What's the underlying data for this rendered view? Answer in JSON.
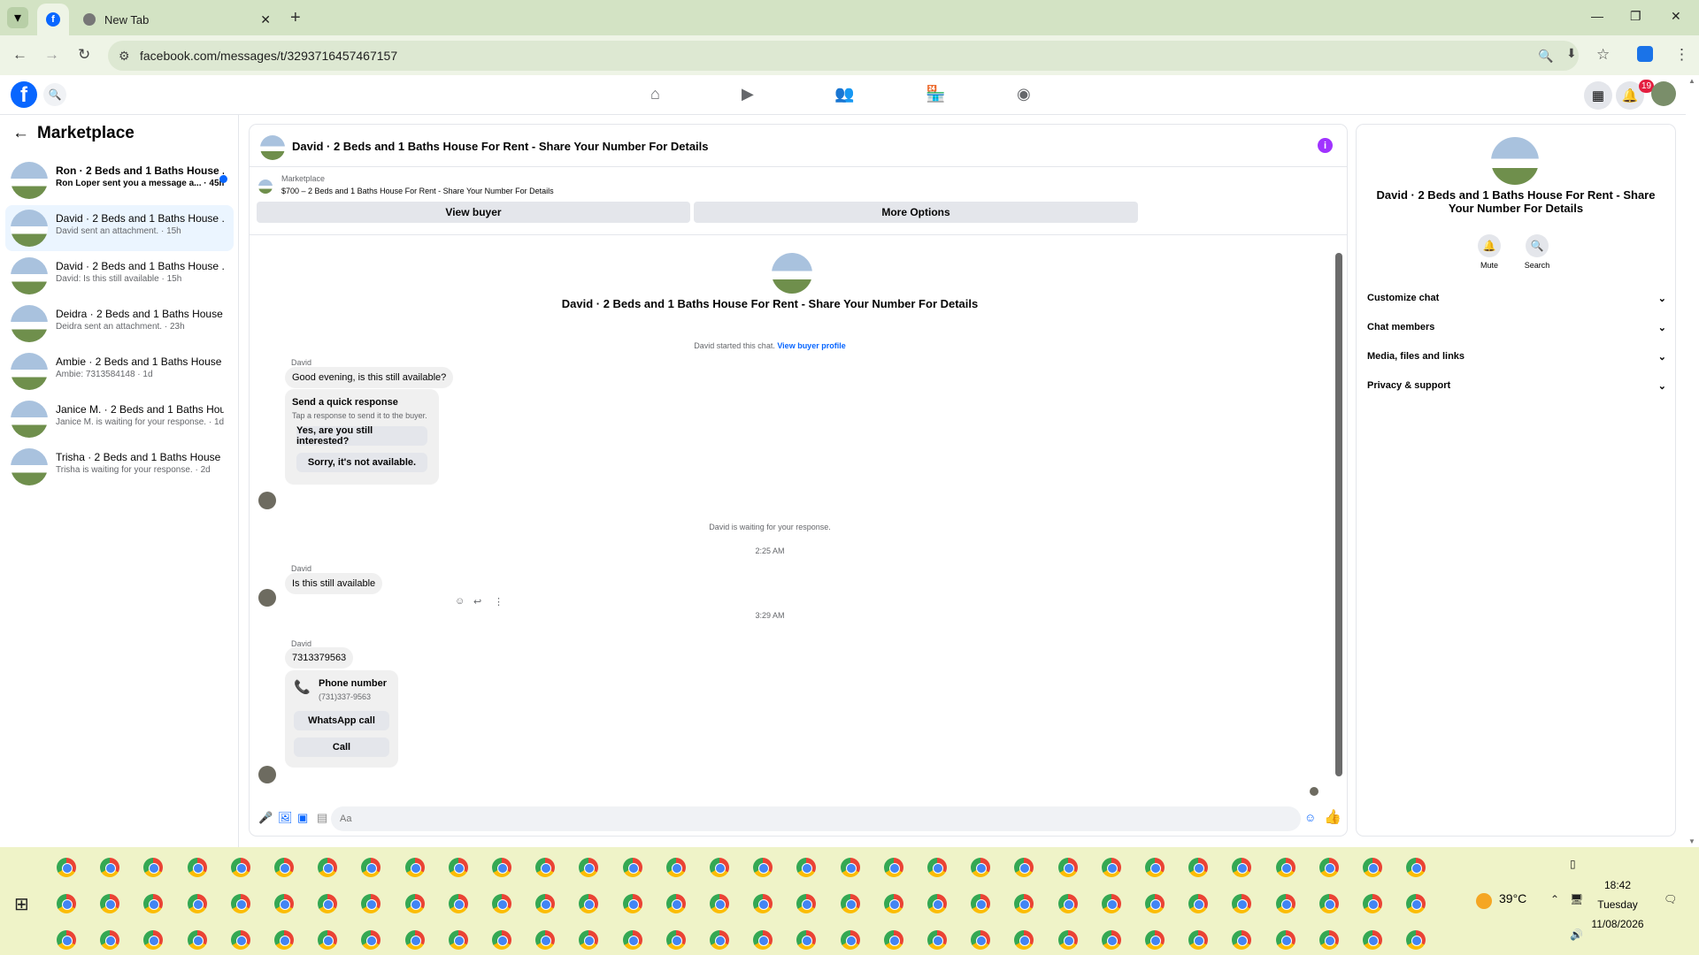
{
  "browser": {
    "tabs": [
      {
        "label": "",
        "icon": "facebook-icon",
        "active": true
      },
      {
        "label": "New Tab",
        "icon": "chrome-icon",
        "active": false
      }
    ],
    "url": "facebook.com/messages/t/3293716457467157"
  },
  "fb": {
    "notif_count": "19"
  },
  "left": {
    "title": "Marketplace",
    "conversations": [
      {
        "name": "Ron · 2 Beds and 1 Baths House ...",
        "preview": "Ron Loper sent you a message a... · 45m",
        "unread": true,
        "selected": false
      },
      {
        "name": "David · 2 Beds and 1 Baths House ...",
        "preview": "David sent an attachment. · 15h",
        "unread": false,
        "selected": true
      },
      {
        "name": "David · 2 Beds and 1 Baths House ...",
        "preview": "David: Is this still available · 15h",
        "unread": false,
        "selected": false
      },
      {
        "name": "Deidra · 2 Beds and 1 Baths House ...",
        "preview": "Deidra sent an attachment. · 23h",
        "unread": false,
        "selected": false
      },
      {
        "name": "Ambie · 2 Beds and 1 Baths House ...",
        "preview": "Ambie: 7313584148 · 1d",
        "unread": false,
        "selected": false
      },
      {
        "name": "Janice M. · 2 Beds and 1 Baths Hou...",
        "preview": "Janice M. is waiting for your response. · 1d",
        "unread": false,
        "selected": false
      },
      {
        "name": "Trisha · 2 Beds and 1 Baths House ...",
        "preview": "Trisha is waiting for your response. · 2d",
        "unread": false,
        "selected": false
      }
    ]
  },
  "chat": {
    "header_title": "David · 2 Beds and 1 Baths House For Rent - Share Your Number For Details",
    "marketplace_label": "Marketplace",
    "listing": "$700 – 2 Beds and 1 Baths House For Rent - Share Your Number For Details",
    "view_buyer": "View buyer",
    "more_options": "More Options",
    "big_title": "David · 2 Beds and 1 Baths House For Rent - Share Your Number For Details",
    "started": "David started this chat.",
    "view_profile": "View buyer profile",
    "sender": "David",
    "msg1": "Good evening, is this still available?",
    "quick_title": "Send a quick response",
    "quick_sub": "Tap a response to send it to the buyer.",
    "quick_opt1": "Yes, are you still interested?",
    "quick_opt2": "Sorry, it's not available.",
    "waiting": "David is waiting for your response.",
    "time1": "2:25 AM",
    "msg2": "Is this still available",
    "time2": "3:29 AM",
    "msg3": "7313379563",
    "phone_title": "Phone number",
    "phone_number": "(731)337-9563",
    "whatsapp": "WhatsApp call",
    "call": "Call",
    "composer_placeholder": "Aa"
  },
  "right": {
    "title": "David · 2 Beds and 1 Baths House For Rent - Share Your Number For Details",
    "mute": "Mute",
    "search": "Search",
    "sections": [
      "Customize chat",
      "Chat members",
      "Media, files and links",
      "Privacy & support"
    ]
  },
  "taskbar": {
    "temperature": "39°C",
    "time": "18:42",
    "day": "Tuesday",
    "date": "11/08/2026"
  },
  "colors": {
    "fb_blue": "#0866ff",
    "tab_bar": "#d3e3c4",
    "taskbar": "#eff3c8"
  }
}
